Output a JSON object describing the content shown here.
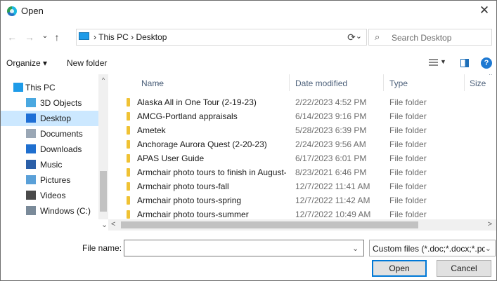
{
  "window": {
    "title": "Open",
    "close_glyph": "✕"
  },
  "nav": {
    "back_icon": "←",
    "forward_icon": "→",
    "dropdown_icon": "⌄",
    "up_icon": "↑",
    "breadcrumb": "› This PC › Desktop",
    "address_chevron": "⌄",
    "refresh_icon": "⟳"
  },
  "search": {
    "placeholder": "Search Desktop",
    "icon": "⌕"
  },
  "toolbar": {
    "organize": "Organize ▾",
    "new_folder": "New folder",
    "help": "?"
  },
  "sidebar": {
    "items": [
      {
        "label": "This PC",
        "icon": "pc-icon",
        "color": "#1e9be8",
        "selected": false
      },
      {
        "label": "3D Objects",
        "icon": "cube-icon",
        "color": "#4aa8e0",
        "selected": false
      },
      {
        "label": "Desktop",
        "icon": "desktop-icon",
        "color": "#1e6fd6",
        "selected": true
      },
      {
        "label": "Documents",
        "icon": "document-icon",
        "color": "#9aa7b5",
        "selected": false
      },
      {
        "label": "Downloads",
        "icon": "download-icon",
        "color": "#1f6fcf",
        "selected": false
      },
      {
        "label": "Music",
        "icon": "music-icon",
        "color": "#2b5fa8",
        "selected": false
      },
      {
        "label": "Pictures",
        "icon": "pictures-icon",
        "color": "#5aa0d8",
        "selected": false
      },
      {
        "label": "Videos",
        "icon": "videos-icon",
        "color": "#4a4a4a",
        "selected": false
      },
      {
        "label": "Windows (C:)",
        "icon": "drive-icon",
        "color": "#7a8a99",
        "selected": false
      }
    ],
    "up_arrow": "^",
    "down_arrow": "⌄"
  },
  "columns": {
    "name": "Name",
    "date": "Date modified",
    "type": "Type",
    "size": "Size"
  },
  "files": [
    {
      "name": "Alaska All in One Tour (2-19-23)",
      "date": "2/22/2023 4:52 PM",
      "type": "File folder"
    },
    {
      "name": "AMCG-Portland appraisals",
      "date": "6/14/2023 9:16 PM",
      "type": "File folder"
    },
    {
      "name": "Ametek",
      "date": "5/28/2023 6:39 PM",
      "type": "File folder"
    },
    {
      "name": "Anchorage Aurora Quest (2-20-23)",
      "date": "2/24/2023 9:56 AM",
      "type": "File folder"
    },
    {
      "name": "APAS User Guide",
      "date": "6/17/2023 6:01 PM",
      "type": "File folder"
    },
    {
      "name": "Armchair photo tours to finish in August-...",
      "date": "8/23/2021 6:46 PM",
      "type": "File folder"
    },
    {
      "name": "Armchair photo tours-fall",
      "date": "12/7/2022 11:41 AM",
      "type": "File folder"
    },
    {
      "name": "Armchair photo tours-spring",
      "date": "12/7/2022 11:42 AM",
      "type": "File folder"
    },
    {
      "name": "Armchair photo tours-summer",
      "date": "12/7/2022 10:49 AM",
      "type": "File folder"
    }
  ],
  "hscroll": {
    "left": "<",
    "right": ">"
  },
  "footer": {
    "file_name_label": "File name:",
    "file_name_value": "",
    "file_name_chevron": "⌄",
    "filter": "Custom files (*.doc;*.docx;*.pdf;",
    "filter_chevron": "⌄",
    "open_label": "Open",
    "cancel_label": "Cancel"
  }
}
